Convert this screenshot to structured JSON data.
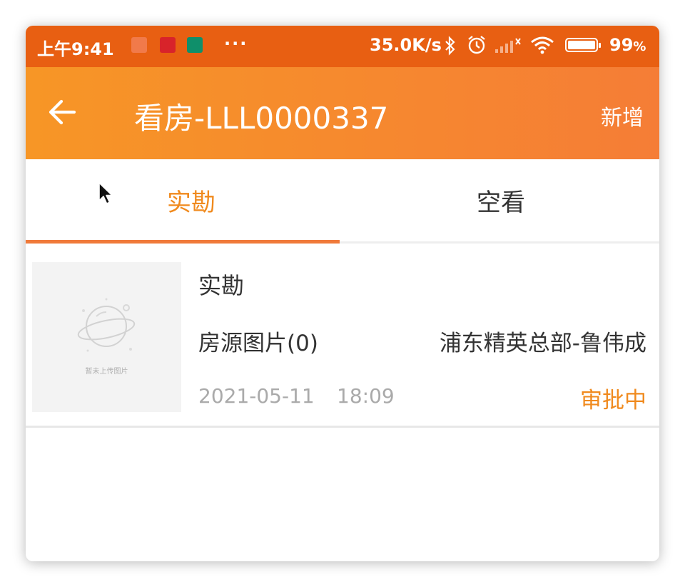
{
  "status_bar": {
    "time": "上午9:41",
    "more": "···",
    "speed": "35.0K/s",
    "battery": "99",
    "battery_unit": "%",
    "icons": [
      "notification-icon",
      "app-icon-red",
      "app-icon-green",
      "bluetooth-icon",
      "alarm-icon",
      "signal-icon",
      "wifi-icon",
      "battery-icon"
    ]
  },
  "header": {
    "title": "看房-LLL0000337",
    "action": "新增",
    "bg_start": "#f79626",
    "bg_end": "#f57d36"
  },
  "tabs": [
    {
      "label": "实勘",
      "active": true
    },
    {
      "label": "空看",
      "active": false
    }
  ],
  "list": [
    {
      "thumb_placeholder": "暂未上传图片",
      "title": "实勘",
      "photos": "房源图片(0)",
      "agent": "浦东精英总部-鲁伟成",
      "date": "2021-05-11",
      "time": "18:09",
      "status": "审批中"
    }
  ],
  "colors": {
    "accent": "#f08a1e",
    "statusbar": "#e85f12",
    "tab_underline": "#f07a3a"
  }
}
